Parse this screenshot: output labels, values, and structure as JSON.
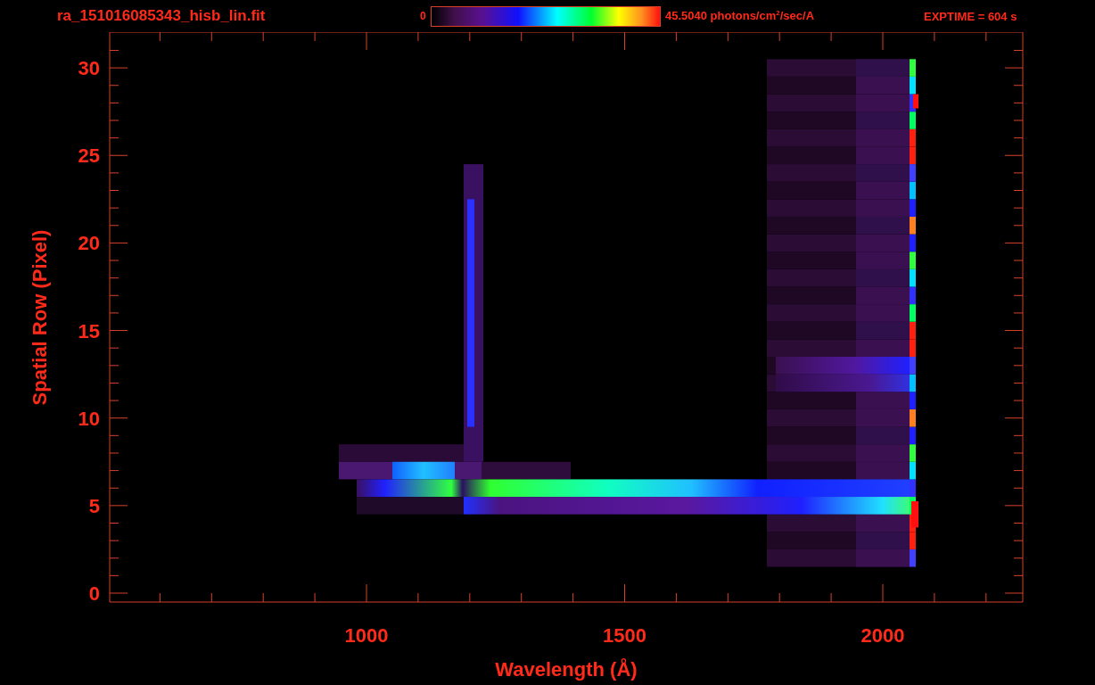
{
  "header": {
    "title": "ra_151016085343_hisb_lin.fit",
    "colorbar": {
      "min_label": "0",
      "max_label": "45.5040 photons/cm$^{2}$/sec/A"
    },
    "exposure": "EXPTIME = 604 s"
  },
  "plot": {
    "xlabel": "Wavelength (Å)",
    "ylabel": "Spatial Row (Pixel)",
    "xticks": [
      "1000",
      "1500",
      "2000"
    ],
    "yticks": [
      "30",
      "25",
      "20",
      "15",
      "10",
      "5",
      "0"
    ]
  }
}
